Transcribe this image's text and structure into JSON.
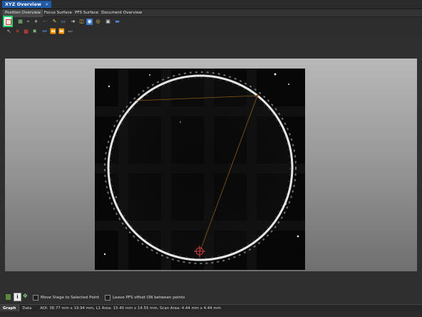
{
  "window": {
    "title": "XYZ Overview",
    "close_glyph": "×"
  },
  "tabs": [
    {
      "label": "Position Overview",
      "active": true
    },
    {
      "label": "Focus Surface",
      "active": false
    },
    {
      "label": "PFS Surface",
      "active": false
    },
    {
      "label": "Document Overview",
      "active": false
    }
  ],
  "toolbar_icons": {
    "row1": [
      "open-icon",
      "grid-icon",
      "crosshair-icon",
      "add-point-icon",
      "minus-icon",
      "pen-icon",
      "rectangle-icon",
      "arrow-right-icon",
      "camera-icon",
      "camera-live-icon",
      "eye-icon",
      "globe-icon",
      "image-icon",
      "monitor-icon"
    ],
    "row2": [
      "pointer-icon",
      "delete-icon",
      "grid-select-icon",
      "cross-icon",
      "first-icon",
      "previous-icon",
      "next-icon",
      "last-icon"
    ]
  },
  "options": {
    "move_stage_label": "Move Stage to Selected Point",
    "leave_pfs_label": "Leave PFS offset ON between points"
  },
  "status": {
    "tabs": [
      {
        "label": "Graph",
        "active": true
      },
      {
        "label": "Data",
        "active": false
      }
    ],
    "text": "AOI: 38.77 mm x 19.94 mm, L1 Area: 15.40 mm x 14.55 mm, Scan Area: 4.44 mm x 4.44 mm"
  },
  "colors": {
    "accent": "#1fd16a",
    "title_tab": "#1f5aa8",
    "path_line": "#8a5a10",
    "marker": "#d04040"
  }
}
